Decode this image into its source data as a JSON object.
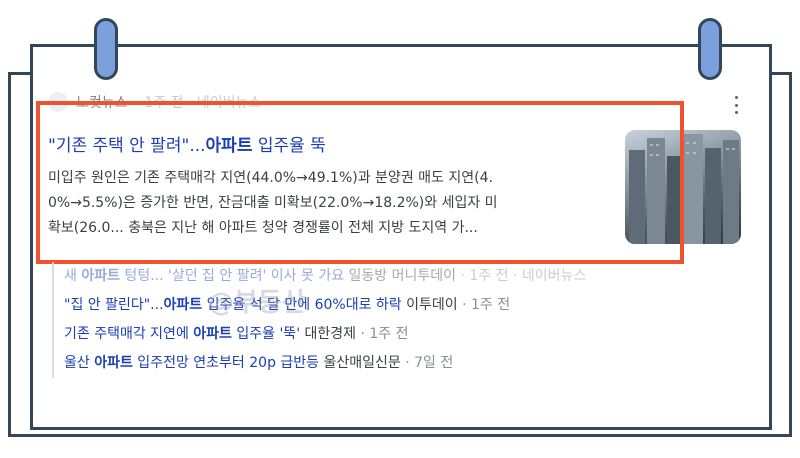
{
  "source": {
    "name": "노컷뉴스",
    "meta": "· 1주 전 · 네이버뉴스"
  },
  "article": {
    "headline_pre": "\"기존 주택 안 팔려\"...",
    "headline_bold": "아파트",
    "headline_post": " 입주율 뚝",
    "snippet_lines": [
      "미입주 원인은 기존 주택매각 지연(44.0%→49.1%)과 분양권 매도 지연(4.",
      "0%→5.5%)은 증가한 반면, 잔금대출 미확보(22.0%→18.2%)와 세입자 미",
      "확보(26.0... 충북은 지난 해 아파트 청약 경쟁률이 전체 지방 도지역 가..."
    ]
  },
  "related": [
    {
      "title_pre": "새 ",
      "title_bold": "아파트",
      "title_post": " 텅텅... '살던 집 안 팔려' 이사 못 가요",
      "publisher": " 일동방 머니투데이",
      "time": " · 1주 전 · 네이버뉴스"
    },
    {
      "title_pre": "\"집 안 팔린다\"...",
      "title_bold": "아파트",
      "title_post": " 입주율 석 달 만에 60%대로 하락",
      "publisher": " 이투데이",
      "time": " · 1주 전"
    },
    {
      "title_pre": "기존 주택매각 지연에 ",
      "title_bold": "아파트",
      "title_post": " 입주율 '뚝'",
      "publisher": " 대한경제",
      "time": " · 1주 전"
    },
    {
      "title_pre": "울산 ",
      "title_bold": "아파트",
      "title_post": " 입주전망 연초부터 20p 급반등",
      "publisher": " 울산매일신문",
      "time": " · 7일 전"
    }
  ],
  "watermark": "@부동산",
  "colors": {
    "highlight": "#f0512e",
    "link": "#1a3fb5",
    "frame": "#34465a",
    "clip": "#7ba0db"
  },
  "icons": {
    "more": "more-vert-icon"
  }
}
